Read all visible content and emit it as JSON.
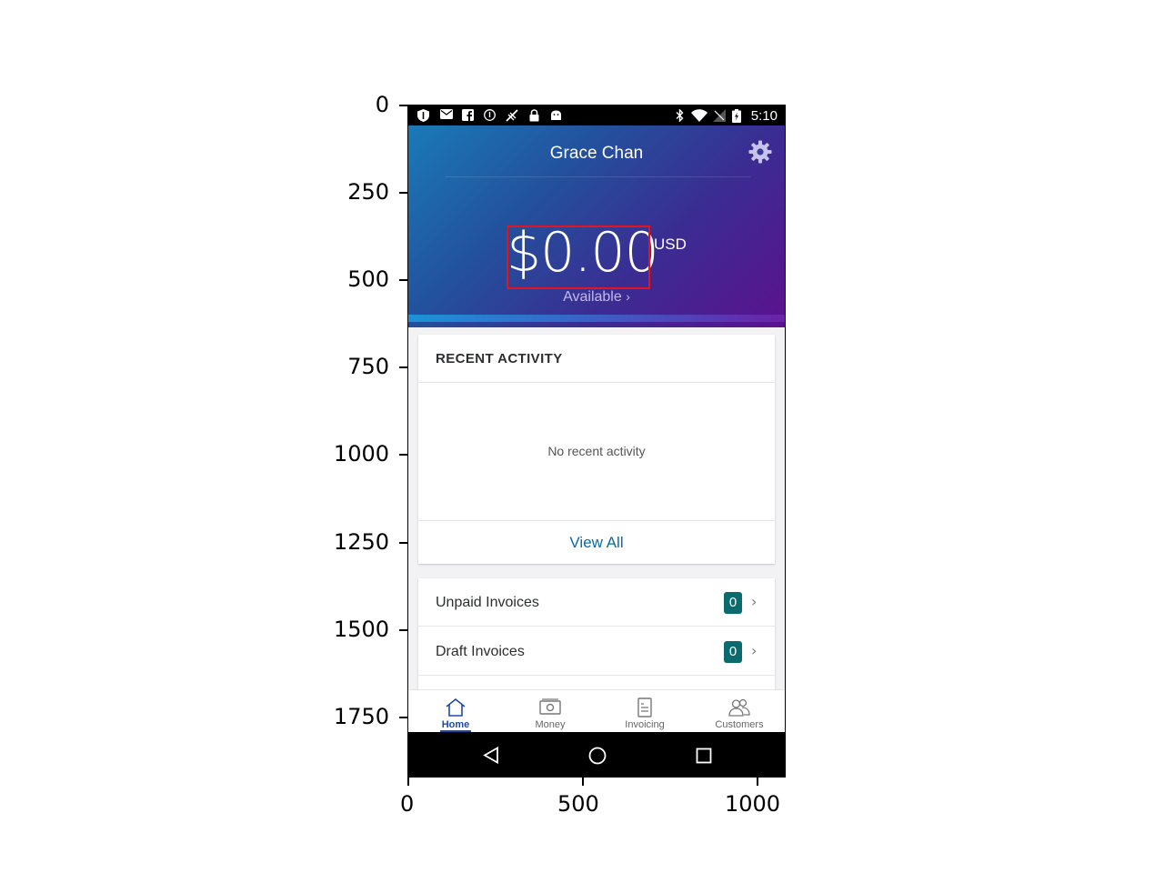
{
  "axes": {
    "y_ticks": [
      "0",
      "250",
      "500",
      "750",
      "1000",
      "1250",
      "1500",
      "1750"
    ],
    "x_ticks": [
      "0",
      "500",
      "1000"
    ]
  },
  "status_bar": {
    "time": "5:10",
    "left_icons": [
      "shield-icon",
      "email-icon",
      "facebook-icon",
      "info-icon",
      "no-signal-icon",
      "lock-icon",
      "android-icon"
    ],
    "right_icons": [
      "bluetooth-icon",
      "wifi-icon",
      "no-sim-icon",
      "battery-charging-icon"
    ]
  },
  "header": {
    "user_name": "Grace Chan",
    "balance": "$0.00",
    "currency": "USD",
    "available_label": "Available",
    "colors": {
      "gradient_start": "#1a7ab8",
      "gradient_end": "#5c118e",
      "highlight_box": "#e3141c"
    }
  },
  "recent_activity": {
    "title": "RECENT ACTIVITY",
    "empty_text": "No recent activity",
    "view_all_label": "View All"
  },
  "invoices": [
    {
      "label": "Unpaid Invoices",
      "count": "0"
    },
    {
      "label": "Draft Invoices",
      "count": "0"
    }
  ],
  "bottom_nav": {
    "items": [
      {
        "label": "Home",
        "icon": "home-icon",
        "active": true
      },
      {
        "label": "Money",
        "icon": "money-icon",
        "active": false
      },
      {
        "label": "Invoicing",
        "icon": "invoice-icon",
        "active": false
      },
      {
        "label": "Customers",
        "icon": "customers-icon",
        "active": false
      }
    ]
  },
  "android_nav": [
    "back-icon",
    "home-circle-icon",
    "recents-icon"
  ]
}
